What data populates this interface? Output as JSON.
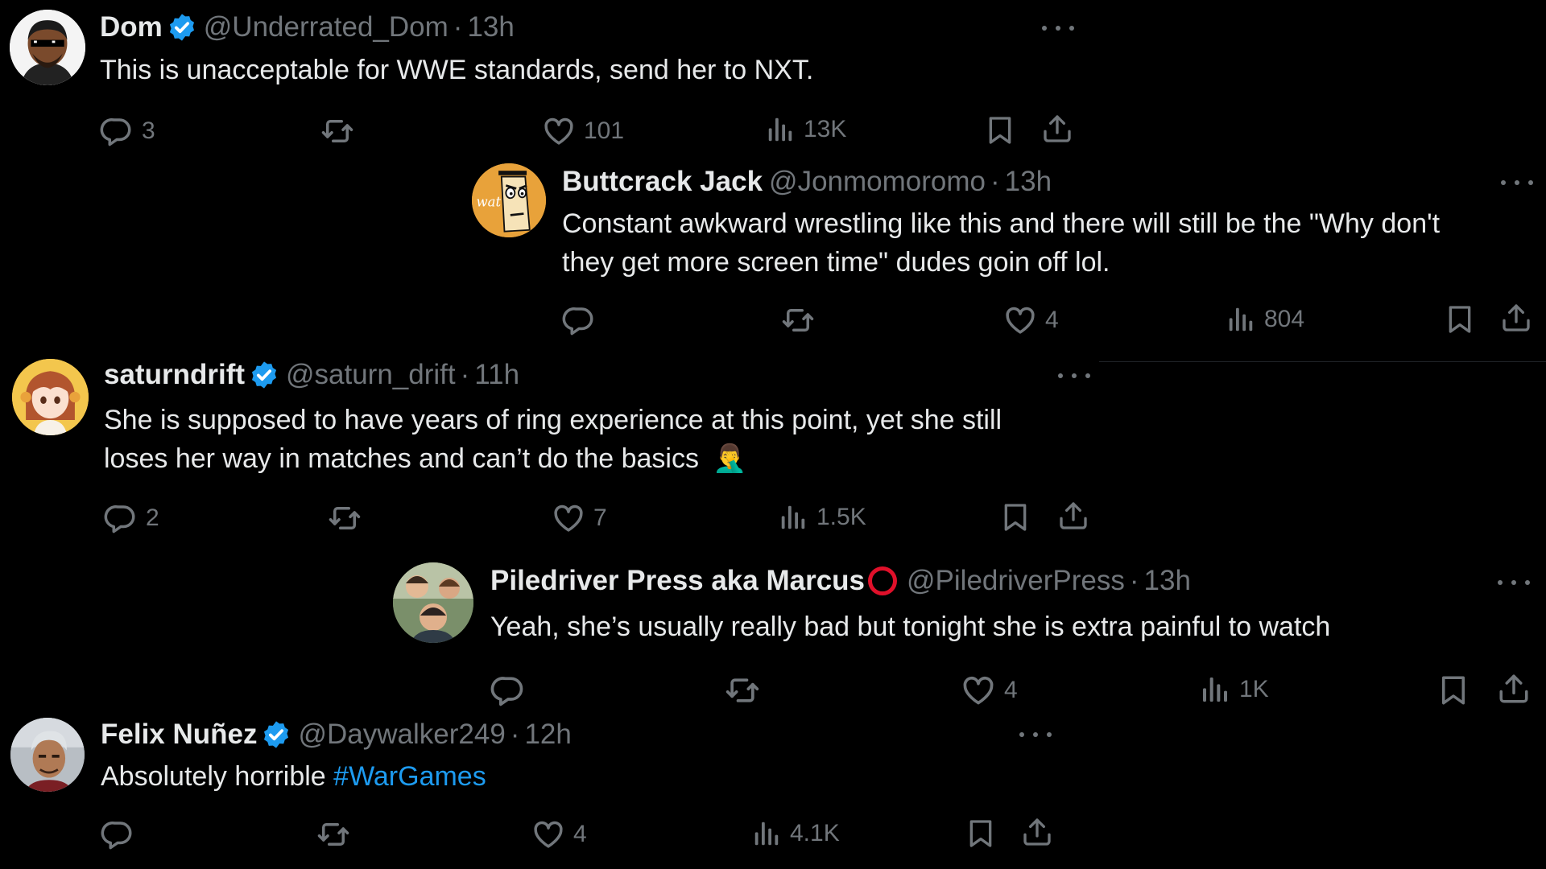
{
  "tweets": [
    {
      "name": "Dom",
      "handle": "@Underrated_Dom",
      "sep": "·",
      "time": "13h",
      "text": "This is unacceptable for WWE standards, send her to NXT.",
      "reply_count": "3",
      "like_count": "101",
      "view_count": "13K"
    },
    {
      "name": "Buttcrack Jack",
      "handle": "@Jonmomoromo",
      "sep": "·",
      "time": "13h",
      "text_line1": "Constant awkward wrestling like this and there will still be the \"Why don't",
      "text_line2": "they get more screen time\" dudes goin off lol.",
      "like_count": "4",
      "view_count": "804",
      "avatar_text": "wat"
    },
    {
      "name": "saturndrift",
      "handle": "@saturn_drift",
      "sep": "·",
      "time": "11h",
      "text_line1": "She is supposed to have years of ring experience at this point, yet she still",
      "text_line2": "loses her way in matches and can’t do the basics",
      "emoji": "🤦‍♂️",
      "reply_count": "2",
      "like_count": "7",
      "view_count": "1.5K"
    },
    {
      "name": "Piledriver Press aka Marcus",
      "handle": "@PiledriverPress",
      "sep": "·",
      "time": "13h",
      "text": "Yeah, she’s usually really bad but tonight she is extra painful to watch",
      "like_count": "4",
      "view_count": "1K"
    },
    {
      "name": "Felix Nuñez",
      "handle": "@Daywalker249",
      "sep": "·",
      "time": "12h",
      "text": "Absolutely horrible ",
      "hashtag": "#WarGames",
      "like_count": "4",
      "view_count": "4.1K"
    }
  ],
  "icons": {
    "reply": "reply-icon",
    "retweet": "retweet-icon",
    "like": "heart-icon",
    "views": "views-icon",
    "bookmark": "bookmark-icon",
    "share": "share-icon",
    "more": "more-icon",
    "verified": "verified-badge-icon"
  },
  "colors": {
    "background": "#000000",
    "text": "#e7e9ea",
    "secondary": "#71767b",
    "verified": "#1d9bf0",
    "link": "#1d9bf0",
    "circle_badge": "#e0102a"
  }
}
